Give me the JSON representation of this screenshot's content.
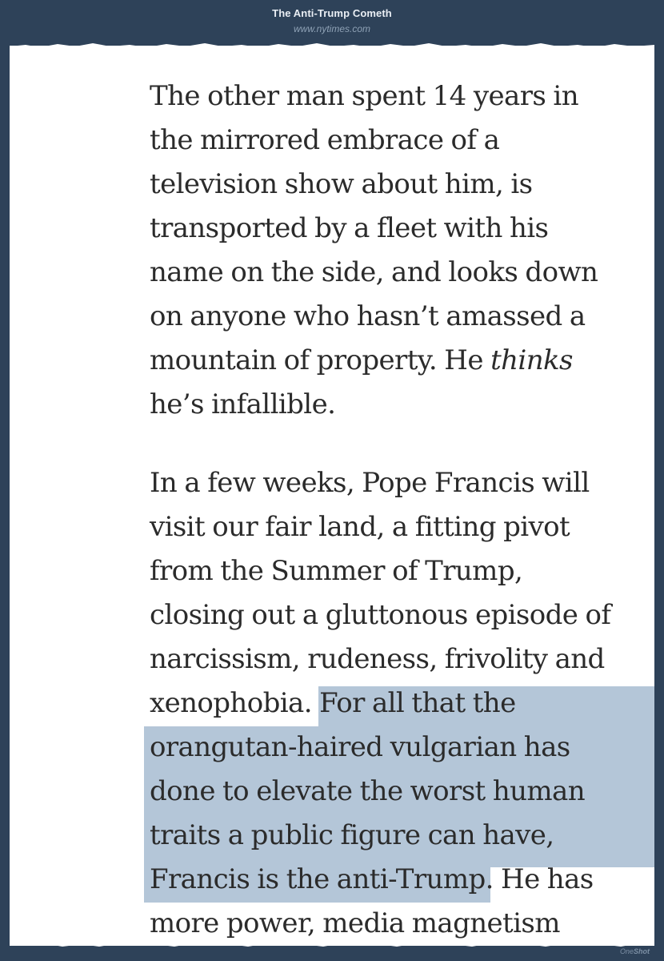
{
  "header": {
    "title": "The Anti-Trump Cometh",
    "url": "www.nytimes.com"
  },
  "article": {
    "p1": [
      "The other man spent 14 years in",
      "the mirrored embrace of a",
      "television show about him, is",
      "transported by a fleet with his",
      "name on the side, and looks down",
      "on anyone who hasn’t amassed a",
      "mountain of property. He ",
      "thinks",
      "he’s infallible."
    ],
    "p2": [
      "In a few weeks, Pope Francis will",
      "visit our fair land, a fitting pivot",
      "from the Summer of Trump,",
      "closing out a gluttonous episode of",
      "narcissism, rudeness, frivolity and",
      "xenophobia. For all that the",
      "orangutan-haired vulgarian has",
      "done to elevate the worst human",
      "traits a public figure can have,",
      "Francis is the anti-Trump. He has",
      "more power, media magnetism"
    ]
  },
  "footer": {
    "brand_a": "One",
    "brand_b": "Shot"
  },
  "colors": {
    "background": "#2e4259",
    "paper": "#ffffff",
    "highlight": "#b4c6d8",
    "text": "#2b2b2b"
  }
}
